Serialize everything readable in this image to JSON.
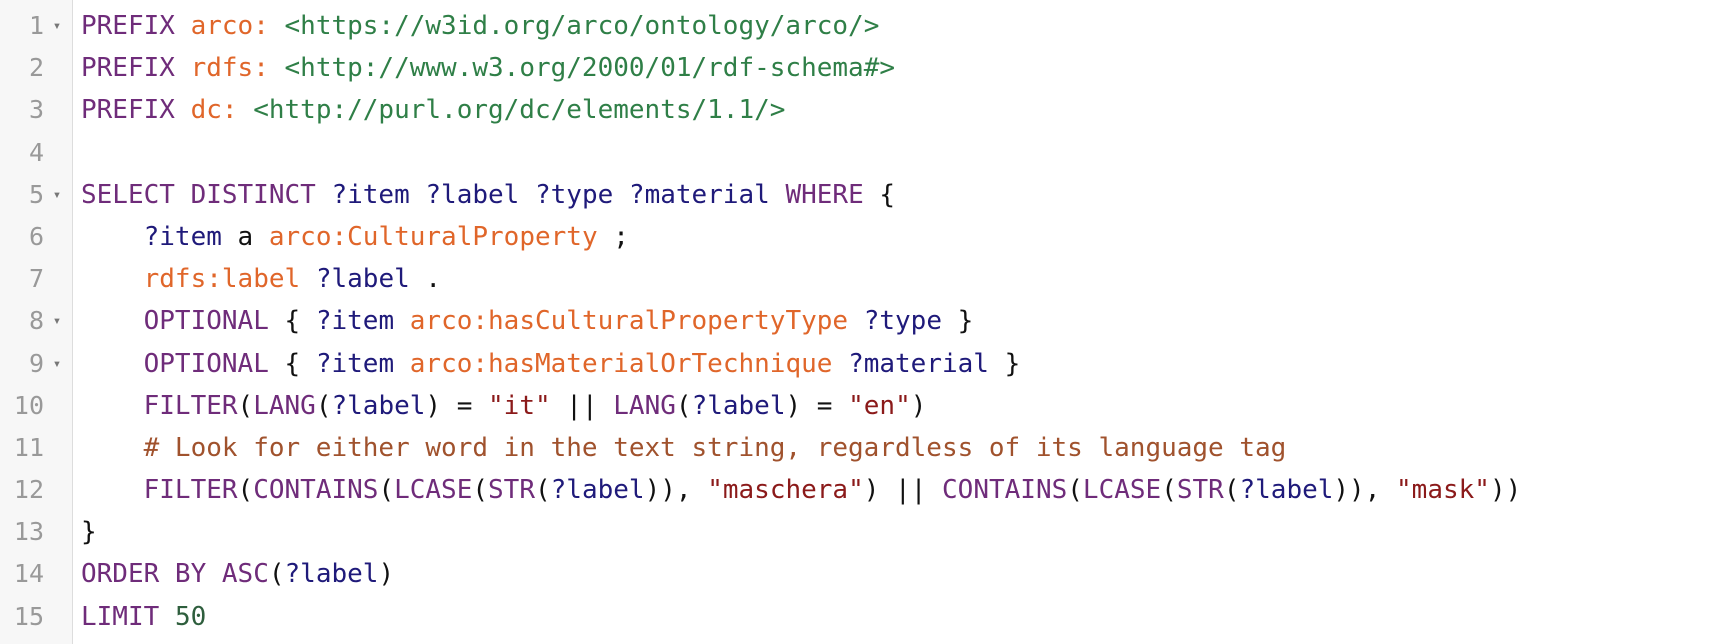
{
  "editor": {
    "language": "SPARQL",
    "colors": {
      "keyword": "#6f2c7a",
      "prefixed_name": "#e0662a",
      "iri": "#2f7f47",
      "variable": "#1f1a7a",
      "string": "#8b1a1a",
      "comment": "#a0522d",
      "number": "#2e5e3d",
      "line_number": "#999999",
      "gutter_bg": "#f7f7f7"
    },
    "lines": [
      {
        "number": "1",
        "fold": "▾",
        "tokens": [
          {
            "t": "kw",
            "v": "PREFIX"
          },
          {
            "t": "punc",
            "v": " "
          },
          {
            "t": "pfx",
            "v": "arco:"
          },
          {
            "t": "punc",
            "v": " "
          },
          {
            "t": "iri",
            "v": "<https://w3id.org/arco/ontology/arco/>"
          }
        ]
      },
      {
        "number": "2",
        "fold": "",
        "tokens": [
          {
            "t": "kw",
            "v": "PREFIX"
          },
          {
            "t": "punc",
            "v": " "
          },
          {
            "t": "pfx",
            "v": "rdfs:"
          },
          {
            "t": "punc",
            "v": " "
          },
          {
            "t": "iri",
            "v": "<http://www.w3.org/2000/01/rdf-schema#>"
          }
        ]
      },
      {
        "number": "3",
        "fold": "",
        "tokens": [
          {
            "t": "kw",
            "v": "PREFIX"
          },
          {
            "t": "punc",
            "v": " "
          },
          {
            "t": "pfx",
            "v": "dc:"
          },
          {
            "t": "punc",
            "v": " "
          },
          {
            "t": "iri",
            "v": "<http://purl.org/dc/elements/1.1/>"
          }
        ]
      },
      {
        "number": "4",
        "fold": "",
        "tokens": []
      },
      {
        "number": "5",
        "fold": "▾",
        "tokens": [
          {
            "t": "kw",
            "v": "SELECT DISTINCT"
          },
          {
            "t": "punc",
            "v": " "
          },
          {
            "t": "var",
            "v": "?item"
          },
          {
            "t": "punc",
            "v": " "
          },
          {
            "t": "var",
            "v": "?label"
          },
          {
            "t": "punc",
            "v": " "
          },
          {
            "t": "var",
            "v": "?type"
          },
          {
            "t": "punc",
            "v": " "
          },
          {
            "t": "var",
            "v": "?material"
          },
          {
            "t": "punc",
            "v": " "
          },
          {
            "t": "kw",
            "v": "WHERE"
          },
          {
            "t": "punc",
            "v": " {"
          }
        ]
      },
      {
        "number": "6",
        "fold": "",
        "tokens": [
          {
            "t": "punc",
            "v": "    "
          },
          {
            "t": "var",
            "v": "?item"
          },
          {
            "t": "punc",
            "v": " a "
          },
          {
            "t": "pfx",
            "v": "arco:CulturalProperty"
          },
          {
            "t": "punc",
            "v": " ;"
          }
        ]
      },
      {
        "number": "7",
        "fold": "",
        "tokens": [
          {
            "t": "punc",
            "v": "    "
          },
          {
            "t": "pfx",
            "v": "rdfs:label"
          },
          {
            "t": "punc",
            "v": " "
          },
          {
            "t": "var",
            "v": "?label"
          },
          {
            "t": "punc",
            "v": " ."
          }
        ]
      },
      {
        "number": "8",
        "fold": "▾",
        "tokens": [
          {
            "t": "punc",
            "v": "    "
          },
          {
            "t": "kw",
            "v": "OPTIONAL"
          },
          {
            "t": "punc",
            "v": " { "
          },
          {
            "t": "var",
            "v": "?item"
          },
          {
            "t": "punc",
            "v": " "
          },
          {
            "t": "pfx",
            "v": "arco:hasCulturalPropertyType"
          },
          {
            "t": "punc",
            "v": " "
          },
          {
            "t": "var",
            "v": "?type"
          },
          {
            "t": "punc",
            "v": " }"
          }
        ]
      },
      {
        "number": "9",
        "fold": "▾",
        "tokens": [
          {
            "t": "punc",
            "v": "    "
          },
          {
            "t": "kw",
            "v": "OPTIONAL"
          },
          {
            "t": "punc",
            "v": " { "
          },
          {
            "t": "var",
            "v": "?item"
          },
          {
            "t": "punc",
            "v": " "
          },
          {
            "t": "pfx",
            "v": "arco:hasMaterialOrTechnique"
          },
          {
            "t": "punc",
            "v": " "
          },
          {
            "t": "var",
            "v": "?material"
          },
          {
            "t": "punc",
            "v": " }"
          }
        ]
      },
      {
        "number": "10",
        "fold": "",
        "tokens": [
          {
            "t": "punc",
            "v": "    "
          },
          {
            "t": "fn",
            "v": "FILTER"
          },
          {
            "t": "punc",
            "v": "("
          },
          {
            "t": "fn",
            "v": "LANG"
          },
          {
            "t": "punc",
            "v": "("
          },
          {
            "t": "var",
            "v": "?label"
          },
          {
            "t": "punc",
            "v": ") = "
          },
          {
            "t": "str",
            "v": "\"it\""
          },
          {
            "t": "punc",
            "v": " || "
          },
          {
            "t": "fn",
            "v": "LANG"
          },
          {
            "t": "punc",
            "v": "("
          },
          {
            "t": "var",
            "v": "?label"
          },
          {
            "t": "punc",
            "v": ") = "
          },
          {
            "t": "str",
            "v": "\"en\""
          },
          {
            "t": "punc",
            "v": ")"
          }
        ]
      },
      {
        "number": "11",
        "fold": "",
        "tokens": [
          {
            "t": "punc",
            "v": "    "
          },
          {
            "t": "cmt",
            "v": "# Look for either word in the text string, regardless of its language tag"
          }
        ]
      },
      {
        "number": "12",
        "fold": "",
        "tokens": [
          {
            "t": "punc",
            "v": "    "
          },
          {
            "t": "fn",
            "v": "FILTER"
          },
          {
            "t": "punc",
            "v": "("
          },
          {
            "t": "fn",
            "v": "CONTAINS"
          },
          {
            "t": "punc",
            "v": "("
          },
          {
            "t": "fn",
            "v": "LCASE"
          },
          {
            "t": "punc",
            "v": "("
          },
          {
            "t": "fn",
            "v": "STR"
          },
          {
            "t": "punc",
            "v": "("
          },
          {
            "t": "var",
            "v": "?label"
          },
          {
            "t": "punc",
            "v": ")), "
          },
          {
            "t": "str",
            "v": "\"maschera\""
          },
          {
            "t": "punc",
            "v": ") || "
          },
          {
            "t": "fn",
            "v": "CONTAINS"
          },
          {
            "t": "punc",
            "v": "("
          },
          {
            "t": "fn",
            "v": "LCASE"
          },
          {
            "t": "punc",
            "v": "("
          },
          {
            "t": "fn",
            "v": "STR"
          },
          {
            "t": "punc",
            "v": "("
          },
          {
            "t": "var",
            "v": "?label"
          },
          {
            "t": "punc",
            "v": ")), "
          },
          {
            "t": "str",
            "v": "\"mask\""
          },
          {
            "t": "punc",
            "v": "))"
          }
        ]
      },
      {
        "number": "13",
        "fold": "",
        "tokens": [
          {
            "t": "punc",
            "v": "}"
          }
        ]
      },
      {
        "number": "14",
        "fold": "",
        "tokens": [
          {
            "t": "kw",
            "v": "ORDER BY"
          },
          {
            "t": "punc",
            "v": " "
          },
          {
            "t": "fn",
            "v": "ASC"
          },
          {
            "t": "punc",
            "v": "("
          },
          {
            "t": "var",
            "v": "?label"
          },
          {
            "t": "punc",
            "v": ")"
          }
        ]
      },
      {
        "number": "15",
        "fold": "",
        "tokens": [
          {
            "t": "kw",
            "v": "LIMIT"
          },
          {
            "t": "punc",
            "v": " "
          },
          {
            "t": "num",
            "v": "50"
          }
        ]
      }
    ]
  }
}
